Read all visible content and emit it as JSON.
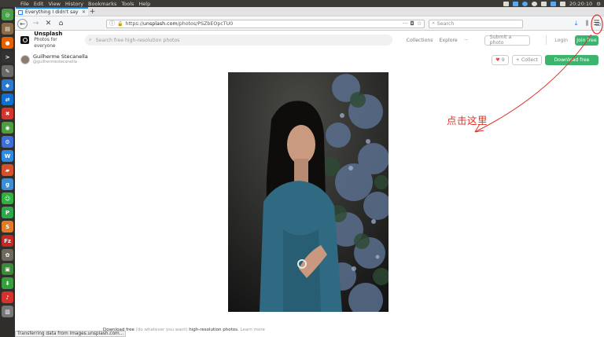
{
  "os": {
    "menus": [
      "File",
      "Edit",
      "View",
      "History",
      "Bookmarks",
      "Tools",
      "Help"
    ],
    "time": "20:20:10"
  },
  "launcher": {
    "items": [
      {
        "icon": "dash-icon",
        "glyph": "◎",
        "color": "#4aa04a"
      },
      {
        "icon": "files-icon",
        "glyph": "▤",
        "color": "#8a6a45"
      },
      {
        "icon": "firefox-icon",
        "glyph": "●",
        "color": "#e66000"
      },
      {
        "icon": "terminal-icon",
        "glyph": ">",
        "color": "#333333"
      },
      {
        "icon": "text-editor-icon",
        "glyph": "✎",
        "color": "#6a6a6a"
      },
      {
        "icon": "vscode-icon",
        "glyph": "◆",
        "color": "#2a7bd0"
      },
      {
        "icon": "teamviewer-icon",
        "glyph": "⇄",
        "color": "#0e6fd3"
      },
      {
        "icon": "xmind-icon",
        "glyph": "✖",
        "color": "#d9342b"
      },
      {
        "icon": "chrome-icon",
        "glyph": "◉",
        "color": "#4b9d3e"
      },
      {
        "icon": "settings-icon",
        "glyph": "⚙",
        "color": "#3d6fd8"
      },
      {
        "icon": "wps-writer-icon",
        "glyph": "W",
        "color": "#2d8be5"
      },
      {
        "icon": "wps-presentation-icon",
        "glyph": "▰",
        "color": "#d8502a"
      },
      {
        "icon": "shutter-icon",
        "glyph": "g",
        "color": "#3c8fd6"
      },
      {
        "icon": "wechat-icon",
        "glyph": "☺",
        "color": "#2fb040"
      },
      {
        "icon": "pycharm-icon",
        "glyph": "P",
        "color": "#2ba84a"
      },
      {
        "icon": "sublime-icon",
        "glyph": "S",
        "color": "#e37b22"
      },
      {
        "icon": "filezilla-icon",
        "glyph": "Fz",
        "color": "#c42a22"
      },
      {
        "icon": "gimp-icon",
        "glyph": "✿",
        "color": "#6f6a5e"
      },
      {
        "icon": "monitor-icon",
        "glyph": "▣",
        "color": "#3a8a3a"
      },
      {
        "icon": "install-icon",
        "glyph": "⬇",
        "color": "#35a03a"
      },
      {
        "icon": "netease-music-icon",
        "glyph": "♪",
        "color": "#d8302a"
      },
      {
        "icon": "trash-icon",
        "glyph": "▥",
        "color": "#777777"
      }
    ]
  },
  "browser": {
    "tab_title": "Everything I didn't say p",
    "url_prefix": "https://",
    "url_domain": "unsplash.com",
    "url_path": "/photos/PSZbEOpcTU0",
    "search_placeholder": "Search"
  },
  "site": {
    "brand": "Unsplash",
    "tagline": "Photos for everyone",
    "search_placeholder": "Search free high-resolution photos",
    "links": [
      "Collections",
      "Explore",
      "···"
    ],
    "submit": "Submit a photo",
    "login": "Login",
    "join": "Join free"
  },
  "author": {
    "name": "Guilherme Stecanella",
    "username": "@guilhermestecanella",
    "like_count": "9",
    "collect": "Collect",
    "download": "Download free"
  },
  "annotation": {
    "text": "点击这里",
    "color": "#e0312a"
  },
  "footer": {
    "note_main": "Download free",
    "note_paren": "(do whatever you want)",
    "note_rest": "high-resolution photos.",
    "note_link": "Learn more",
    "status": "Transferring data from images.unsplash.com..."
  }
}
